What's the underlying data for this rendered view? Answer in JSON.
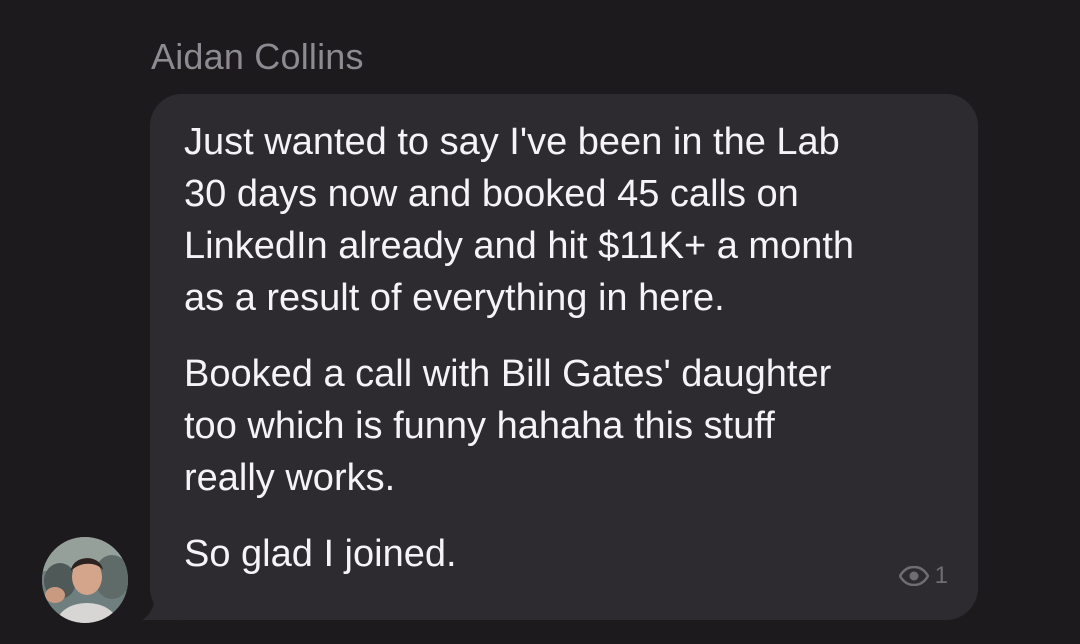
{
  "message": {
    "sender": "Aidan Collins",
    "paragraphs": [
      "Just wanted to say I've been in the Lab\n30 days now and booked 45 calls on\nLinkedIn already and hit $11K+ a month\nas a result of everything in here.",
      "Booked a call with Bill Gates' daughter\ntoo which is funny hahaha this stuff\nreally works.",
      "So glad I joined."
    ],
    "view_count": "1",
    "view_icon": "eye-icon",
    "avatar": "avatar-photo"
  },
  "colors": {
    "background": "#1c1a1d",
    "bubble": "#2d2b30",
    "text": "#f4f3f6",
    "name": "#8d8a91",
    "meta": "#6f6c74"
  }
}
